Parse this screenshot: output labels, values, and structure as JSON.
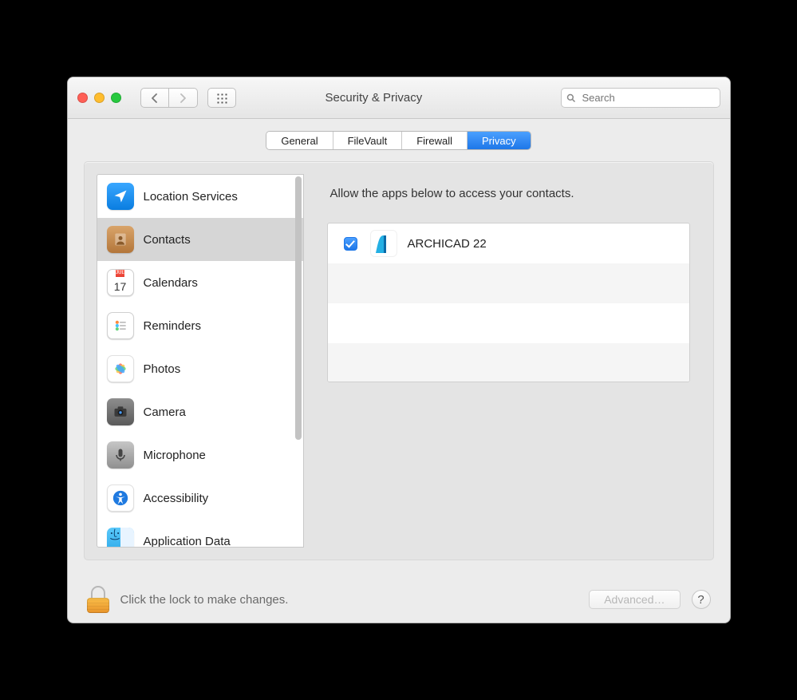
{
  "window": {
    "title": "Security & Privacy"
  },
  "toolbar": {
    "search_placeholder": "Search"
  },
  "tabs": [
    {
      "label": "General",
      "active": false
    },
    {
      "label": "FileVault",
      "active": false
    },
    {
      "label": "Firewall",
      "active": false
    },
    {
      "label": "Privacy",
      "active": true
    }
  ],
  "sidebar": {
    "selected_index": 1,
    "items": [
      {
        "label": "Location Services",
        "icon": "location"
      },
      {
        "label": "Contacts",
        "icon": "contacts"
      },
      {
        "label": "Calendars",
        "icon": "calendars",
        "calendar_day": "17",
        "calendar_month": "JUL"
      },
      {
        "label": "Reminders",
        "icon": "reminders"
      },
      {
        "label": "Photos",
        "icon": "photos"
      },
      {
        "label": "Camera",
        "icon": "camera"
      },
      {
        "label": "Microphone",
        "icon": "microphone"
      },
      {
        "label": "Accessibility",
        "icon": "accessibility"
      },
      {
        "label": "Application Data",
        "icon": "finder"
      }
    ]
  },
  "content": {
    "prompt": "Allow the apps below to access your contacts.",
    "apps": [
      {
        "name": "ARCHICAD 22",
        "checked": true
      }
    ]
  },
  "footer": {
    "lock_text": "Click the lock to make changes.",
    "advanced_label": "Advanced…",
    "help_label": "?"
  }
}
